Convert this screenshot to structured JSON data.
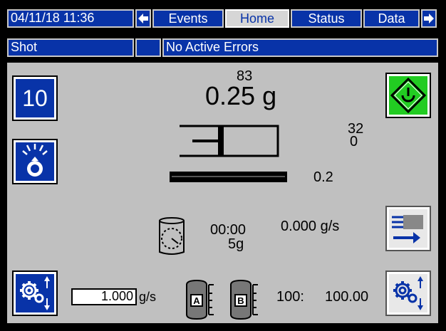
{
  "header": {
    "datetime": "04/11/18 11:36",
    "tabs": [
      {
        "label": "Events",
        "active": false
      },
      {
        "label": "Home",
        "active": true
      },
      {
        "label": "Status",
        "active": false
      },
      {
        "label": "Data",
        "active": false
      }
    ],
    "mode": "Shot",
    "errors": "No Active Errors"
  },
  "main": {
    "shot_number": "10",
    "shot_small_top": "83",
    "shot_size": "0.25 g",
    "right_top_value": "32",
    "right_bottom_value": "0",
    "bar_value": "0.2",
    "timer": "00:00",
    "weight": "5g",
    "flow_readout": "0.000 g/s",
    "flow_input_value": "1.000",
    "flow_unit": "g/s",
    "tank_a_label": "A",
    "tank_b_label": "B",
    "ratio_left": "100:",
    "ratio_right": "100.00"
  },
  "colors": {
    "accent": "#0833a8",
    "start_green": "#22cc22",
    "panel_grey": "#c0c0c0"
  },
  "icons": {
    "prev": "arrow-left-icon",
    "next": "arrow-right-icon",
    "start": "start-icon",
    "dispense": "dispense-icon",
    "settings": "gears-icon",
    "purge": "purge-icon",
    "timer": "timer-icon"
  }
}
